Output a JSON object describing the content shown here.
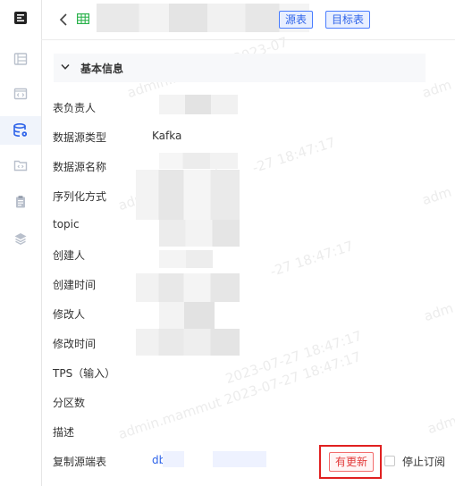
{
  "sidebar": {
    "items": [
      {
        "icon": "app-menu-icon"
      },
      {
        "icon": "list-icon"
      },
      {
        "icon": "code-window-icon"
      },
      {
        "icon": "database-settings-icon"
      },
      {
        "icon": "folder-code-icon"
      },
      {
        "icon": "clipboard-icon"
      },
      {
        "icon": "layers-icon"
      }
    ]
  },
  "header": {
    "source_table_label": "源表",
    "target_table_label": "目标表"
  },
  "section": {
    "title": "基本信息"
  },
  "fields": {
    "owner_label": "表负责人",
    "datasource_type_label": "数据源类型",
    "datasource_type_value": "Kafka",
    "datasource_name_label": "数据源名称",
    "serialization_label": "序列化方式",
    "topic_label": "topic",
    "creator_label": "创建人",
    "created_time_label": "创建时间",
    "modifier_label": "修改人",
    "modified_time_label": "修改时间",
    "tps_label": "TPS（输入）",
    "partitions_label": "分区数",
    "description_label": "描述",
    "replication_label": "复制源端表",
    "replication_value": "db"
  },
  "actions": {
    "update_available_label": "有更新",
    "stop_subscription_label": "停止订阅",
    "stop_subscription_checked": false
  },
  "watermark": {
    "text_a": "admin.mammut 2023-07",
    "text_b": "admin.mammut",
    "text_c": "-27 18:47:17",
    "text_d": "2023-07-27 18:47:17",
    "text_e": "admin.mammut 2023-07-27 18:47:17",
    "text_f": "adm"
  }
}
